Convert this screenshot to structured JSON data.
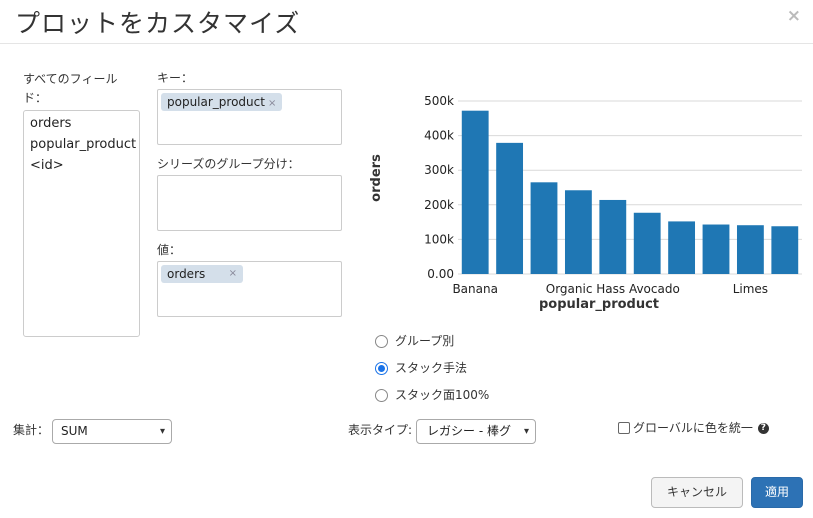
{
  "dialog": {
    "title": "プロットをカスタマイズ",
    "close_label": "×"
  },
  "all_fields": {
    "label": "すべてのフィールド：",
    "items": [
      "orders",
      "popular_product",
      "<id>"
    ]
  },
  "key": {
    "label": "キー：",
    "chips": [
      {
        "text": "popular_product",
        "remove": "×"
      }
    ]
  },
  "series_group": {
    "label": "シリーズのグループ分け："
  },
  "values": {
    "label": "値：",
    "chips": [
      {
        "text": "orders",
        "remove": "×"
      }
    ]
  },
  "stacking": {
    "options": [
      {
        "label": "グループ別",
        "checked": false
      },
      {
        "label": "スタック手法",
        "checked": true
      },
      {
        "label": "スタック面100%",
        "checked": false
      }
    ]
  },
  "aggregation": {
    "label": "集計：",
    "value": "SUM"
  },
  "display_type": {
    "label": "表示タイプ:",
    "value": "レガシー - 棒グ"
  },
  "global_color": {
    "label": "グローバルに色を統一",
    "checked": false,
    "help_icon": "question-circle-icon"
  },
  "buttons": {
    "cancel": "キャンセル",
    "apply": "適用"
  },
  "chart_data": {
    "type": "bar",
    "categories": [
      "Banana",
      "",
      "",
      "",
      "Organic Hass Avocado",
      "",
      "",
      "",
      "Limes",
      ""
    ],
    "values": [
      472000,
      379000,
      265000,
      242000,
      214000,
      177000,
      152000,
      143000,
      141000,
      138000
    ],
    "xlabel": "popular_product",
    "ylabel": "orders",
    "ylim": [
      0,
      500000
    ],
    "yticks": [
      "0.00",
      "100k",
      "200k",
      "300k",
      "400k",
      "500k"
    ],
    "ytick_values": [
      0,
      100000,
      200000,
      300000,
      400000,
      500000
    ],
    "grid": true,
    "bar_color": "#1f77b4"
  }
}
